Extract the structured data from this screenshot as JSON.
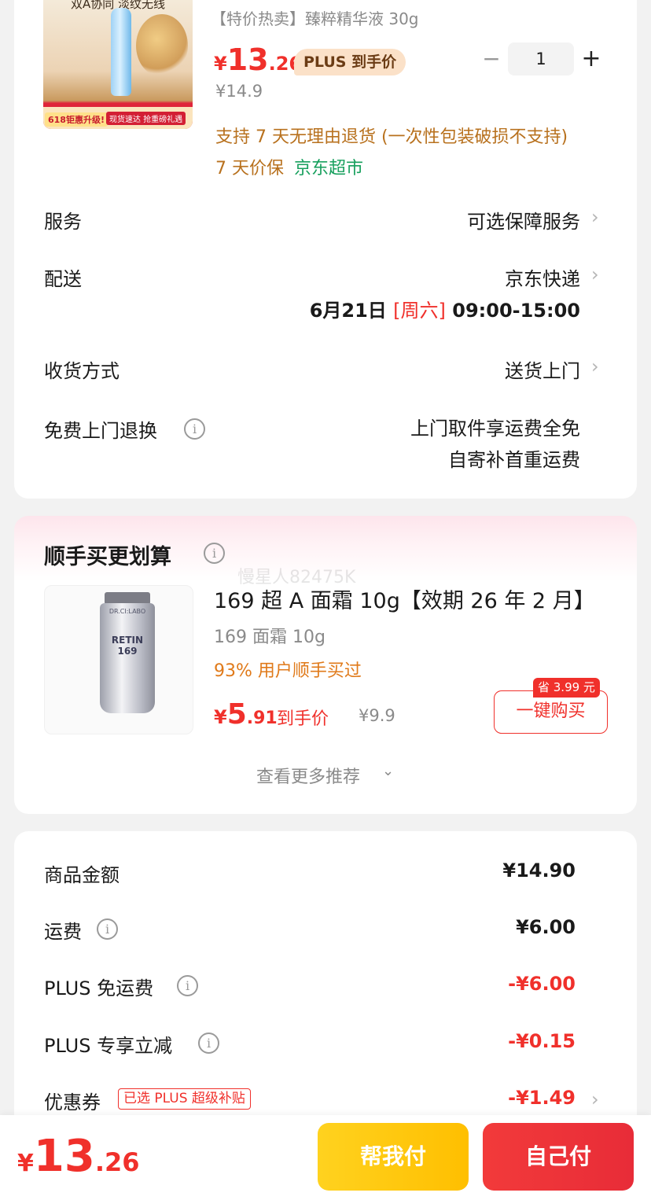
{
  "product": {
    "image_slogan": "双A协同 淡纹无线",
    "image_badge": "618钜惠升级!",
    "image_sub": "现货速达 抢重磅礼遇",
    "title": "【特价热卖】臻粹精华液 30g",
    "price_yen": "¥",
    "price_int": "13",
    "price_dec": ".26",
    "plus_tag": "PLUS 到手价",
    "original_price": "¥14.9",
    "qty_minus": "−",
    "quantity": "1",
    "qty_plus": "+",
    "return_note": "支持 7 天无理由退货 (一次性包装破损不支持)",
    "price_guarantee": "7 天价保",
    "store": "京东超市"
  },
  "details": {
    "service_label": "服务",
    "service_value": "可选保障服务",
    "shipping_label": "配送",
    "shipping_value": "京东快递",
    "shipping_date": "6月21日",
    "shipping_weekday": "[周六]",
    "shipping_window": "09:00-15:00",
    "receive_label": "收货方式",
    "receive_value": "送货上门",
    "free_return_label": "免费上门退换",
    "free_return_line1": "上门取件享运费全免",
    "free_return_line2": "自寄补首重运费",
    "chevron": "›",
    "info": "i"
  },
  "recommend": {
    "title": "顺手买更划算",
    "watermark": "慢星人82475K",
    "image_brand": "DR.CI:LABO",
    "image_label": "RETIN 169",
    "name": "169 超 A 面霜 10g【效期 26 年 2 月】",
    "spec": "169 面霜 10g",
    "users": "93% 用户顺手买过",
    "price_yen": "¥",
    "price_int": "5",
    "price_dec": ".91",
    "price_tag": "到手价",
    "original_price": "¥9.9",
    "save_badge": "省 3.99 元",
    "buy_button": "一键购买",
    "more": "查看更多推荐",
    "more_chevron": "⌄"
  },
  "summary": {
    "rows": [
      {
        "label": "商品金额",
        "value": "¥14.90"
      },
      {
        "label": "运费",
        "value": "¥6.00"
      },
      {
        "label": "PLUS 免运费",
        "value": "-¥6.00"
      },
      {
        "label": "PLUS 专享立减",
        "value": "-¥0.15"
      },
      {
        "label": "优惠券",
        "value": "-¥1.49"
      }
    ],
    "coupon_tag": "已选 PLUS 超级补贴"
  },
  "bottom": {
    "total_yen": "¥",
    "total_int": "13",
    "total_dec": ".26",
    "help_pay": "帮我付",
    "self_pay": "自己付"
  },
  "colors": {
    "accent_red": "#f0302b",
    "help_yellow": "#ffc700",
    "store_green": "#18a05e",
    "note_orange": "#b8711e"
  }
}
